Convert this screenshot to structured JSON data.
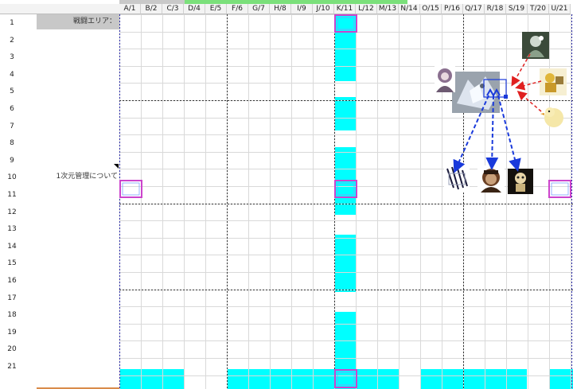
{
  "columns": [
    "A/1",
    "B/2",
    "C/3",
    "D/4",
    "E/5",
    "F/6",
    "G/7",
    "H/8",
    "I/9",
    "J/10",
    "K/11",
    "L/12",
    "M/13",
    "N/14",
    "O/15",
    "P/16",
    "Q/17",
    "R/18",
    "S/19",
    "T/20",
    "U/21"
  ],
  "rows": [
    "1",
    "2",
    "3",
    "4",
    "5",
    "6",
    "7",
    "8",
    "9",
    "10",
    "11",
    "12",
    "13",
    "14",
    "15",
    "16",
    "17",
    "18",
    "19",
    "20",
    "21"
  ],
  "labels": {
    "battle_area": "戦闘エリア：",
    "note": "1次元管理について"
  },
  "colors": {
    "fill": "#00ffff",
    "grid": "#d9d9d9",
    "marker": "#cc44cc",
    "blue_arrow": "#1a3adb",
    "red_arrow": "#e02020",
    "label_bg": "#c8c8c8",
    "top_green": "#7be07b"
  },
  "tokens": [
    {
      "name": "silhouette-token-topright",
      "icon": "dark-figure"
    },
    {
      "name": "yellow-figure-token",
      "icon": "yellow-figure"
    },
    {
      "name": "chick-token",
      "icon": "chick"
    },
    {
      "name": "white-beast-token",
      "icon": "white-beast"
    },
    {
      "name": "hooded-figure-token",
      "icon": "hooded-figure"
    },
    {
      "name": "zebra-token",
      "icon": "zebra"
    },
    {
      "name": "brown-warrior-token",
      "icon": "brown-warrior"
    },
    {
      "name": "skeleton-token",
      "icon": "skeleton"
    }
  ]
}
